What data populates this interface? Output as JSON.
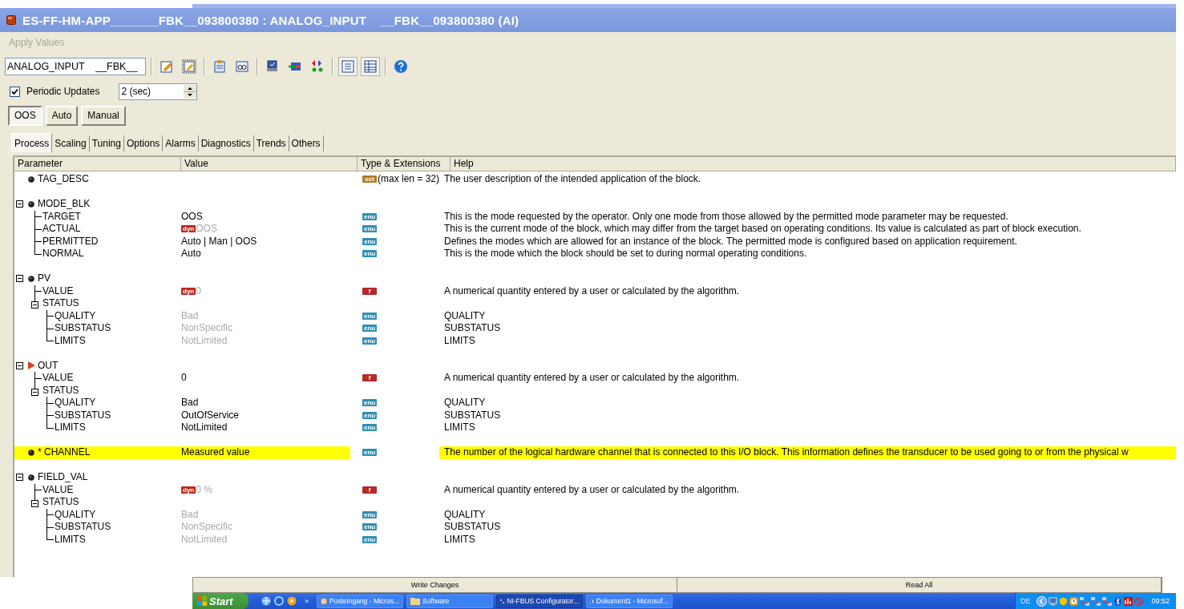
{
  "window": {
    "title": "ES-FF-HM-APP_______FBK__093800380 : ANALOG_INPUT    __FBK__093800380 (AI)"
  },
  "menu": [
    {
      "label": "Apply Values",
      "disabled": true
    }
  ],
  "toolbar": {
    "block_select": "ANALOG_INPUT    __FBK__",
    "groups": [
      [
        {
          "kind": "notepad",
          "pressed": false
        },
        {
          "kind": "notepad-frame",
          "pressed": false
        }
      ],
      [
        {
          "kind": "clipboard",
          "pressed": false
        },
        {
          "kind": "glasses",
          "pressed": false
        }
      ],
      [
        {
          "kind": "computer",
          "pressed": false
        },
        {
          "kind": "card-arrow",
          "pressed": false
        },
        {
          "kind": "shapes",
          "pressed": false
        }
      ],
      [
        {
          "kind": "list",
          "pressed": true
        },
        {
          "kind": "table",
          "pressed": true
        }
      ],
      [
        {
          "kind": "help",
          "pressed": false
        }
      ]
    ]
  },
  "periodic_updates": {
    "label": "Periodic Updates",
    "checked": true,
    "interval": "2 (sec)"
  },
  "modes": [
    {
      "label": "OOS",
      "selected": true
    },
    {
      "label": "Auto",
      "selected": false
    },
    {
      "label": "Manual",
      "selected": false
    }
  ],
  "tabs": [
    {
      "label": "Process",
      "selected": true
    },
    {
      "label": "Scaling",
      "selected": false
    },
    {
      "label": "Tuning",
      "selected": false
    },
    {
      "label": "Options",
      "selected": false
    },
    {
      "label": "Alarms",
      "selected": false
    },
    {
      "label": "Diagnostics",
      "selected": false
    },
    {
      "label": "Trends",
      "selected": false
    },
    {
      "label": "Others",
      "selected": false
    }
  ],
  "table": {
    "columns": [
      "Parameter",
      "Value",
      "Type & Extensions",
      "Help"
    ],
    "rows": [
      {
        "name": "TAG_DESC",
        "kind": "bullet",
        "type": "oct",
        "type_text": "(max len = 32)",
        "help": "The user description of the intended application of the block."
      },
      {
        "name": "MODE_BLK",
        "kind": "bullet",
        "expanded": true,
        "children": [
          {
            "name": "TARGET",
            "value": "OOS",
            "type": "enu",
            "help": "This is the mode requested by the operator.  Only one mode from those allowed by the permitted mode parameter may be requested."
          },
          {
            "name": "ACTUAL",
            "value": "OOS",
            "dynamic": "dyn",
            "dim": true,
            "type": "enu",
            "help": "This is the current mode of the block, which may differ from the target based on operating conditions.  Its value is calculated as part of block execution."
          },
          {
            "name": "PERMITTED",
            "value": "Auto | Man | OOS",
            "type": "enu",
            "help": "Defines the modes which are allowed for an instance of the block.  The permitted mode is configured based on application requirement."
          },
          {
            "name": "NORMAL",
            "value": "Auto",
            "type": "enu",
            "help": "This is the mode which the block should be set to during normal operating conditions."
          }
        ]
      },
      {
        "name": "PV",
        "kind": "bullet",
        "expanded": true,
        "children": [
          {
            "name": "VALUE",
            "value": "0",
            "dynamic": "dyn",
            "dim": true,
            "type": "f",
            "help": "A numerical quantity entered by a user or calculated by the algorithm."
          },
          {
            "name": "STATUS",
            "expanded": true,
            "children": [
              {
                "name": "QUALITY",
                "value": "Bad",
                "dim": true,
                "type": "enu",
                "help": "QUALITY"
              },
              {
                "name": "SUBSTATUS",
                "value": "NonSpecific",
                "dim": true,
                "type": "enu",
                "help": "SUBSTATUS"
              },
              {
                "name": "LIMITS",
                "value": "NotLimited",
                "dim": true,
                "type": "enu",
                "help": "LIMITS"
              }
            ]
          }
        ]
      },
      {
        "name": "OUT",
        "kind": "arrow",
        "expanded": true,
        "children": [
          {
            "name": "VALUE",
            "value": "0",
            "type": "f",
            "help": "A numerical quantity entered by a user or calculated by the algorithm."
          },
          {
            "name": "STATUS",
            "expanded": true,
            "children": [
              {
                "name": "QUALITY",
                "value": "Bad",
                "type": "enu",
                "help": "QUALITY"
              },
              {
                "name": "SUBSTATUS",
                "value": "OutOfService",
                "type": "enu",
                "help": "SUBSTATUS"
              },
              {
                "name": "LIMITS",
                "value": "NotLimited",
                "type": "enu",
                "help": "LIMITS"
              }
            ]
          }
        ]
      },
      {
        "name": "* CHANNEL",
        "kind": "bullet",
        "highlighted": true,
        "value": "Measured value",
        "type": "enu",
        "help": "The number of the logical hardware channel that is connected to this I/O block. This information defines the transducer to be used going to or from the physical w"
      },
      {
        "name": "FIELD_VAL",
        "kind": "bullet",
        "expanded": true,
        "children": [
          {
            "name": "VALUE",
            "value": "0 %",
            "dynamic": "dyn",
            "dim": true,
            "type": "f",
            "help": "A numerical quantity entered by a user or calculated by the algorithm."
          },
          {
            "name": "STATUS",
            "expanded": true,
            "children": [
              {
                "name": "QUALITY",
                "value": "Bad",
                "dim": true,
                "type": "enu",
                "help": "QUALITY"
              },
              {
                "name": "SUBSTATUS",
                "value": "NonSpecific",
                "dim": true,
                "type": "enu",
                "help": "SUBSTATUS"
              },
              {
                "name": "LIMITS",
                "value": "NotLimited",
                "dim": true,
                "type": "enu",
                "help": "LIMITS"
              }
            ]
          }
        ]
      }
    ]
  },
  "actions": [
    "Write Changes",
    "Read All"
  ],
  "taskbar": {
    "start": "Start",
    "more": "»",
    "tasks": [
      {
        "label": "Posteingang - Micros...",
        "kind": "clock",
        "selected": false
      },
      {
        "label": "Software",
        "kind": "folder",
        "selected": false
      },
      {
        "label": "NI-FBUS Configurator...",
        "kind": "network",
        "selected": true
      },
      {
        "label": "Dokument1 - Microsof...",
        "kind": "document",
        "selected": false
      }
    ],
    "language": "DE",
    "time": "09:52"
  }
}
